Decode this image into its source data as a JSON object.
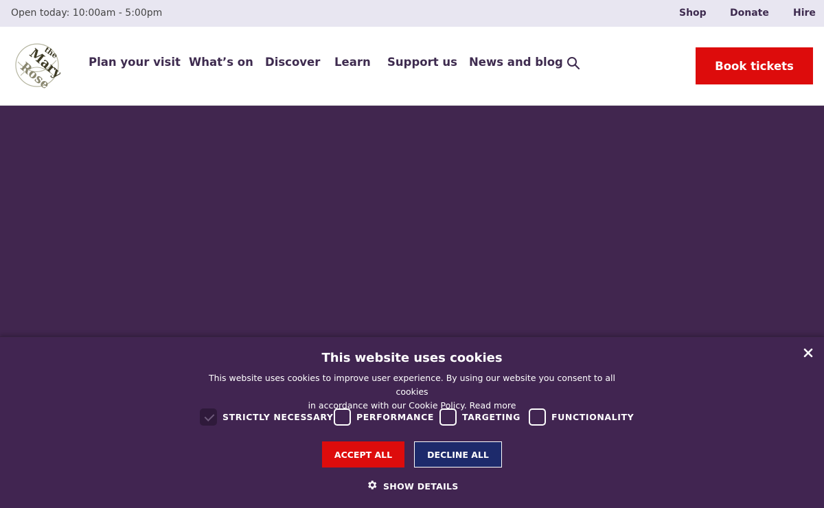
{
  "topbar": {
    "hours": "Open today: 10:00am - 5:00pm",
    "links": [
      "Shop",
      "Donate",
      "Hire"
    ]
  },
  "header": {
    "logo_text": "the Mary Rose",
    "nav": [
      "Plan your visit",
      "What’s on",
      "Discover",
      "Learn",
      "Support us",
      "News and blog"
    ],
    "search_icon": "search-icon",
    "book_label": "Book tickets"
  },
  "colors": {
    "brand_purple": "#41264f",
    "accent_red": "#dd0c0c",
    "decline_blue": "#1d2a6b",
    "topbar_bg": "#e8e6f1"
  },
  "cookie": {
    "title": "This website uses cookies",
    "text_line1": "This website uses cookies to improve user experience. By using our website you consent to all cookies",
    "text_line2": "in accordance with our Cookie Policy.",
    "read_more": "Read more",
    "categories": [
      {
        "label": "STRICTLY NECESSARY",
        "checked": true
      },
      {
        "label": "PERFORMANCE",
        "checked": false
      },
      {
        "label": "TARGETING",
        "checked": false
      },
      {
        "label": "FUNCTIONALITY",
        "checked": false
      }
    ],
    "accept_label": "ACCEPT ALL",
    "decline_label": "DECLINE ALL",
    "details_label": "SHOW DETAILS",
    "close_icon": "close-icon",
    "gear_icon": "gear-icon"
  }
}
